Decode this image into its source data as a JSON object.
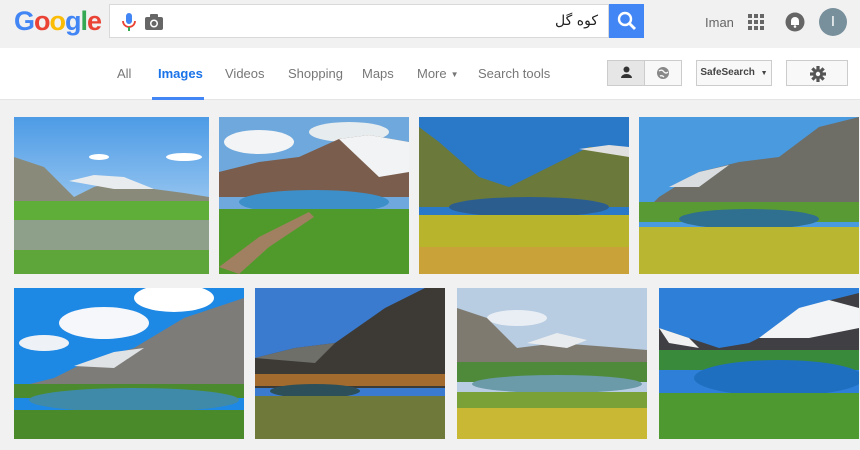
{
  "logo": {
    "letters": [
      "G",
      "o",
      "o",
      "g",
      "l",
      "e"
    ],
    "colors": [
      "#4285f4",
      "#ea4335",
      "#fbbc05",
      "#4285f4",
      "#34a853",
      "#ea4335"
    ]
  },
  "search": {
    "query": "کوه گل"
  },
  "user": {
    "name": "Iman",
    "initial": "I"
  },
  "nav": {
    "tabs": [
      "All",
      "Images",
      "Videos",
      "Shopping",
      "Maps",
      "More",
      "Search tools"
    ],
    "active": "Images",
    "safe_search_label": "SafeSearch"
  },
  "results": {
    "images": [
      {
        "subject": "mountain lake meadow"
      },
      {
        "subject": "mountain lake snow peaks"
      },
      {
        "subject": "mountain valley lake"
      },
      {
        "subject": "mountain lake rocky slopes"
      },
      {
        "subject": "mountain lake cloudy sky"
      },
      {
        "subject": "mountain lake dark peak"
      },
      {
        "subject": "mountain lake yellow flowers"
      },
      {
        "subject": "mountain lake blue water snow"
      }
    ]
  },
  "colors": {
    "accent": "#4285f4",
    "header_bg": "#f1f1f1",
    "navbar_bg": "#ffffff"
  }
}
